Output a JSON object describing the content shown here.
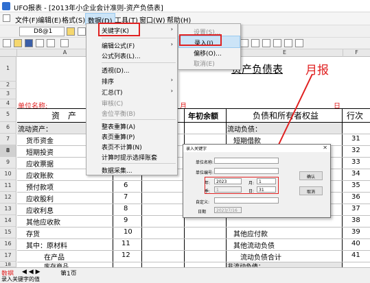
{
  "window": {
    "title": "UFO报表 - [2013年小企业会计准则-资产负债表]"
  },
  "menubar": {
    "file": "文件(F)",
    "edit": "编辑(E)",
    "format": "格式(S)",
    "data": "数据(D)",
    "tools": "工具(T)",
    "window": "窗口(W)",
    "help": "帮助(H)"
  },
  "toolbar": {
    "cell_ref": "D8@1"
  },
  "columns": [
    "A",
    "E",
    "F"
  ],
  "rows": [
    "1",
    "2",
    "3",
    "4",
    "5",
    "6",
    "7",
    "8",
    "9",
    "10",
    "11",
    "12",
    "13",
    "14",
    "15",
    "16",
    "17",
    "18"
  ],
  "sheet": {
    "title": "资产负债表",
    "unit_name": "单位名称:",
    "date_marker_1": "月",
    "date_marker_2": "日",
    "asset_header": "资　产",
    "begin_balance_header": "年初余额",
    "liab_header": "负债和所有者权益",
    "row_no_header": "行次",
    "left_items": [
      "流动资产：",
      "货币资金",
      "短期投资",
      "应收票据",
      "应收账款",
      "预付款项",
      "应收股利",
      "应收利息",
      "其他应收款",
      "存货",
      "其中：原材料",
      "在产品",
      "库存商品"
    ],
    "left_row_numbers": [
      "1",
      "2",
      "3",
      "4",
      "5",
      "6",
      "7",
      "8",
      "9",
      "10",
      "11",
      "12"
    ],
    "right_items": [
      "流动负债：",
      "短期借款",
      "其他应付款",
      "其他流动负债",
      "流动负债合计",
      "非流动负债："
    ],
    "right_row_numbers": [
      "31",
      "32",
      "33",
      "34",
      "35",
      "36",
      "37",
      "38",
      "39",
      "40",
      "41"
    ]
  },
  "data_menu": {
    "items": [
      "关键字(K)",
      "编辑公式(F)",
      "公式列表(L)...",
      "透视(D)...",
      "排序",
      "汇总(T)",
      "审核(C)",
      "舍位平衡(B)",
      "整表重算(A)",
      "表页重算(P)",
      "表页不计算(N)",
      "计算时提示选择账套",
      "数据采集..."
    ]
  },
  "keyword_submenu": {
    "items": [
      "设置(S)...",
      "录入(I) ...",
      "偏移(O)...",
      "取消(E)"
    ]
  },
  "dialog": {
    "title": "录入关键字",
    "unit_name_label": "单位名称:",
    "unit_code_label": "单位编号:",
    "year_label": "年:",
    "year_value": "2023",
    "month_label": "月:",
    "month_value": "1",
    "quarter_label": "季:",
    "quarter_value": "1",
    "day_label": "日:",
    "day_value": "31",
    "custom_label": "自定义:",
    "date_label": "日期",
    "date_value": "2023/7/16",
    "ok_label": "确认",
    "cancel_label": "取消"
  },
  "annotation": {
    "text": "月报"
  },
  "sheet_tabs": {
    "data_label": "数据",
    "page_label": "第1页"
  },
  "status": {
    "text": "录入关键字的值"
  },
  "colors": {
    "accent_red": "#e02020",
    "menu_highlight": "#cce4f7"
  }
}
